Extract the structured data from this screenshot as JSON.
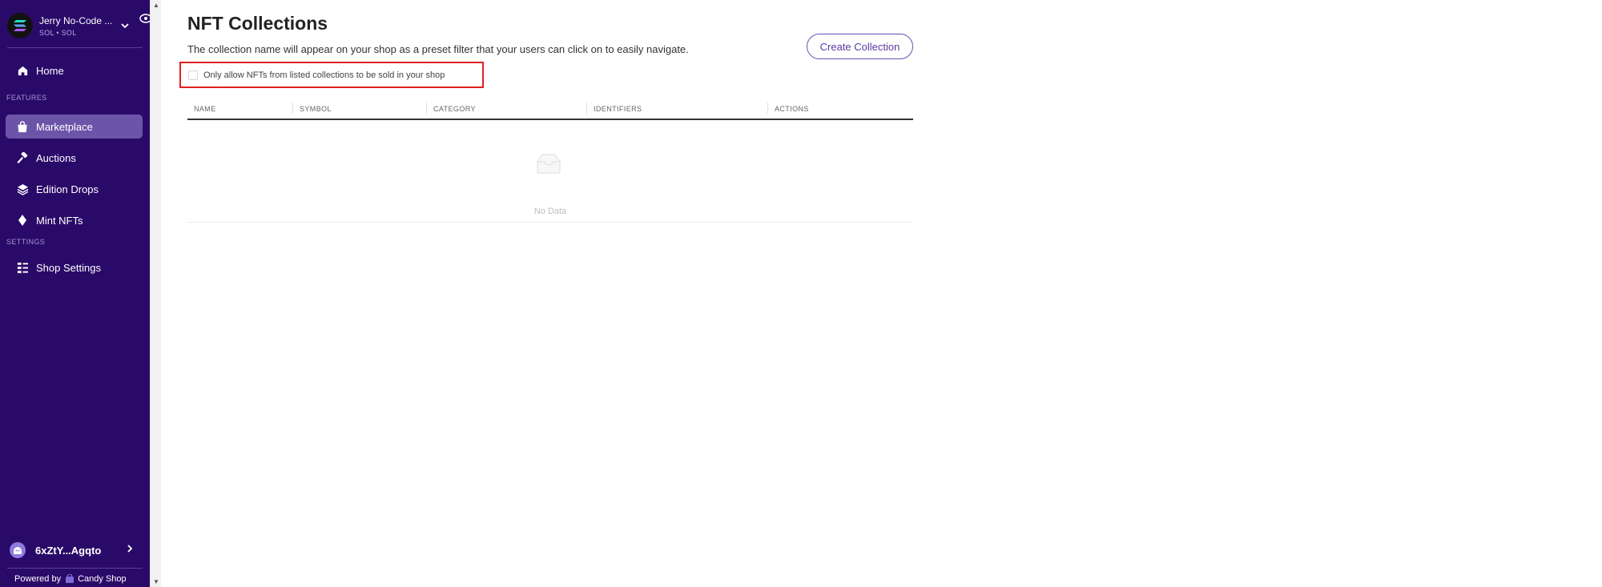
{
  "sidebar": {
    "shop_name": "Jerry No-Code ...",
    "shop_sub": "SOL • SOL",
    "sections": {
      "features": "FEATURES",
      "settings": "SETTINGS"
    },
    "items": [
      {
        "label": "Home",
        "icon": "home-icon"
      },
      {
        "label": "Marketplace",
        "icon": "shopping-bag-icon",
        "active": true
      },
      {
        "label": "Auctions",
        "icon": "gavel-icon"
      },
      {
        "label": "Edition Drops",
        "icon": "layers-icon"
      },
      {
        "label": "Mint NFTs",
        "icon": "diamond-icon"
      },
      {
        "label": "Shop Settings",
        "icon": "settings-list-icon"
      }
    ],
    "wallet": {
      "address": "6xZtY...Agqto"
    },
    "powered_by": {
      "prefix": "Powered by",
      "brand": "Candy Shop"
    }
  },
  "main": {
    "title": "NFT Collections",
    "description": "The collection name will appear on your shop as a preset filter that your users can click on to easily navigate.",
    "create_button": "Create Collection",
    "filter_checkbox": {
      "label": "Only allow NFTs from listed collections to be sold in your shop",
      "checked": false
    },
    "table": {
      "columns": [
        "NAME",
        "SYMBOL",
        "CATEGORY",
        "IDENTIFIERS",
        "ACTIONS"
      ],
      "empty_text": "No Data"
    }
  },
  "colors": {
    "sidebar_bg": "#2a0a69",
    "active_item_bg": "#6c54a8",
    "accent": "#5a3ba3",
    "highlight_border": "#e02020"
  }
}
